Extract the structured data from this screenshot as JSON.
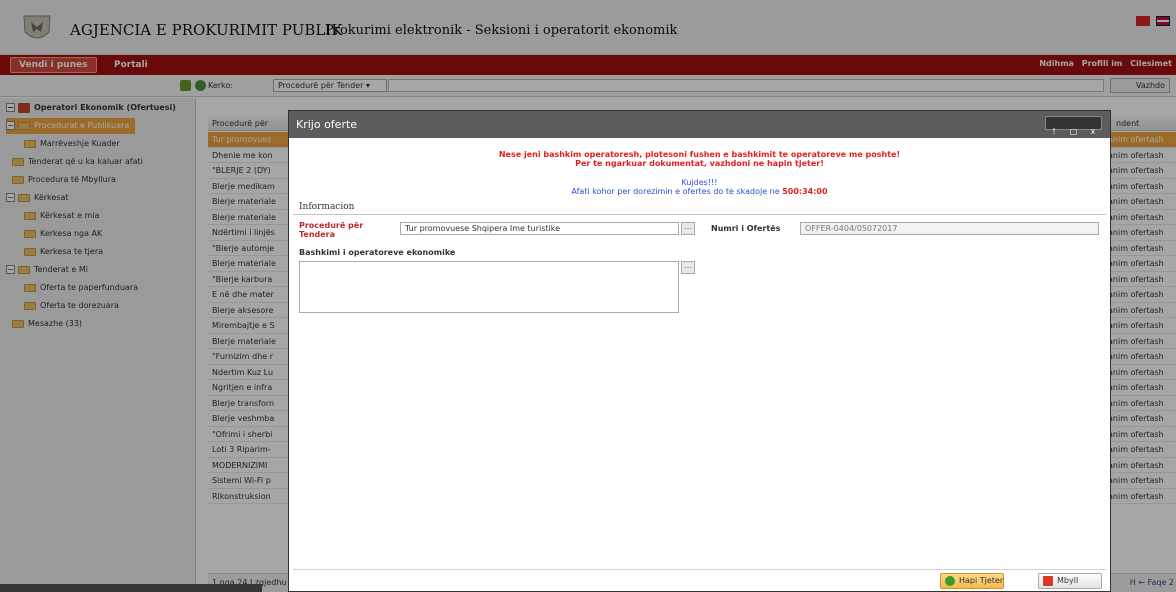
{
  "header": {
    "title": "AGJENCIA E PROKURIMIT PUBLIK",
    "subtitle": "Prokurimi elektronik - Seksioni i operatorit ekonomik"
  },
  "nav": {
    "active_tab": "Vendi i punes",
    "portal_tab": "Portali",
    "right_links": [
      "Ndihma",
      "Profili im",
      "Cilesimet"
    ]
  },
  "search": {
    "label": "Kerko:",
    "select_value": "Procedurë për Tender",
    "button": "Vazhdo"
  },
  "sidebar": {
    "root": "Operatori Ekonomik (Ofertuesi)",
    "items": [
      "Procedurat e Publikuara",
      "Marrëveshje Kuader",
      "Tenderat që u ka kaluar afati",
      "Procedura të Mbyllura",
      "Kërkesat",
      "Kërkesat e mia",
      "Kerkesa nga AK",
      "Kerkesa te tjera",
      "Tenderat e Mi",
      "Oferta te paperfunduara",
      "Oferta te dorezuara",
      "Mesazhe (33)"
    ]
  },
  "grid": {
    "col_procedure": "Procedurë për",
    "col_status": "ndent",
    "rows": [
      {
        "left": "Tur promovues",
        "right": "anim ofertash"
      },
      {
        "left": "Dhenie me kon",
        "right": "anim ofertash"
      },
      {
        "left": "\"BLERJE 2 (DY)",
        "right": "anim ofertash"
      },
      {
        "left": "Blerje medikam",
        "right": "anim ofertash"
      },
      {
        "left": "Blerje materiale",
        "right": "anim ofertash"
      },
      {
        "left": "Blerje materiale",
        "right": "anim ofertash"
      },
      {
        "left": "Ndërtimi i linjës",
        "right": "anim ofertash"
      },
      {
        "left": "\"Blerje automje",
        "right": "anim ofertash"
      },
      {
        "left": "Blerje materiale",
        "right": "anim ofertash"
      },
      {
        "left": "\"Blerje karbura",
        "right": "anim ofertash"
      },
      {
        "left": "E në dhe mater",
        "right": "anim ofertash"
      },
      {
        "left": "Blerje aksesore",
        "right": "anim ofertash"
      },
      {
        "left": "Mirembajtje e S",
        "right": "anim ofertash"
      },
      {
        "left": "Blerje materiale",
        "right": "anim ofertash"
      },
      {
        "left": "\"Furnizim dhe r",
        "right": "anim ofertash"
      },
      {
        "left": "Ndertim Kuz Lu",
        "right": "anim ofertash"
      },
      {
        "left": "Ngritjen e infra",
        "right": "anim ofertash"
      },
      {
        "left": "Blerje transforn",
        "right": "anim ofertash"
      },
      {
        "left": "Blerje veshmba",
        "right": "anim ofertash"
      },
      {
        "left": "\"Ofrimi i sherbi",
        "right": "anim ofertash"
      },
      {
        "left": "Loti 3 Riparim-",
        "right": "anim ofertash"
      },
      {
        "left": "MODERNIZIMI",
        "right": "anim ofertash"
      },
      {
        "left": "Sistemi Wi-Fi p",
        "right": "anim ofertash"
      },
      {
        "left": "Rikonstruksion",
        "right": "anim ofertash"
      }
    ],
    "footer_left": "1 nga 24 I zgjedhu",
    "footer_right": "Faqe 2"
  },
  "modal": {
    "title": "Krijo oferte",
    "window_buttons": [
      "!",
      "□",
      "x"
    ],
    "warning_line1": "Nese jeni bashkim operatoresh, plotesoni fushen e bashkimit te operatoreve me poshte!",
    "warning_line2": "Per te ngarkuar dokumentat, vazhdoni ne hapin tjeter!",
    "careful": "Kujdes!!!",
    "deadline_prefix": "Afati kohor per dorezimin e ofertes do te skadoje ne",
    "deadline_time": "500:34:00",
    "section": "Informacion",
    "procedure_label": "Procedurë për Tendera",
    "procedure_value": "Tur promovuese Shqipera Ime turistike",
    "offer_label": "Numri i Ofertës",
    "offer_value": "OFFER-0404/05072017",
    "join_label": "Bashkimi i operatoreve ekonomike",
    "next_button": "Hapi Tjeter",
    "close_button": "Mbyll"
  },
  "colors": {
    "nav_bg": "#a30f0f",
    "accent_orange": "#f0a540",
    "warning_red": "#e02020",
    "info_blue": "#2a4fd0",
    "modal_title_bg": "#5c5c5c"
  }
}
